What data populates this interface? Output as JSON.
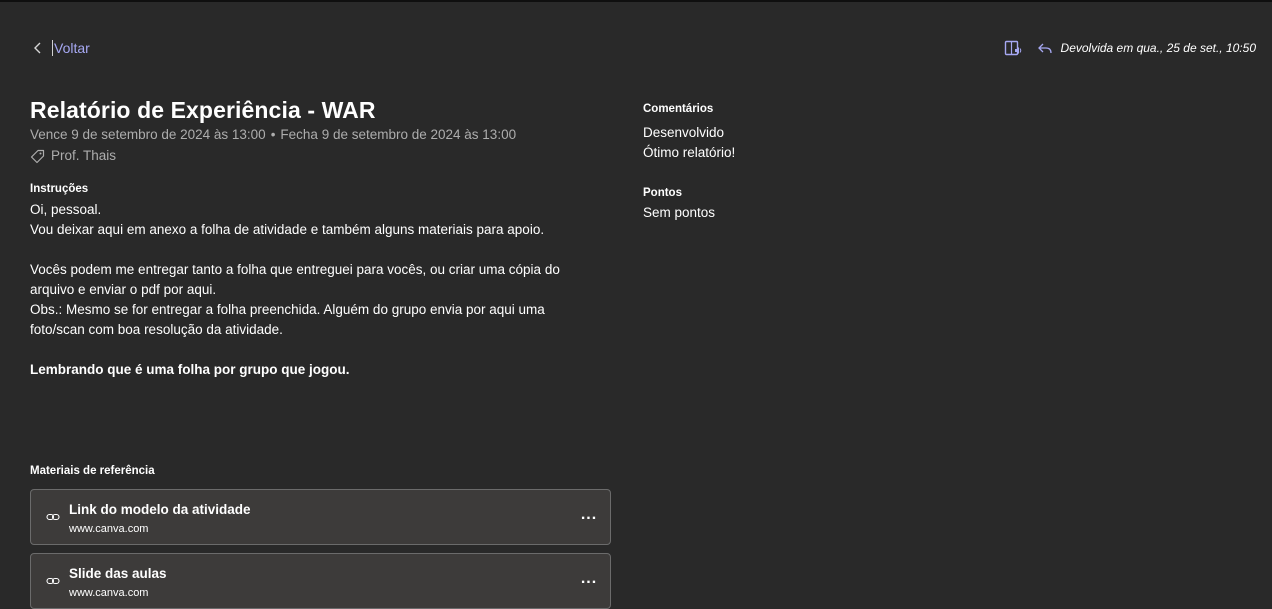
{
  "header": {
    "back_label": "Voltar",
    "returned_label": "Devolvida em qua., 25 de set., 10:50"
  },
  "assignment": {
    "title": "Relatório de Experiência - WAR",
    "due": "Vence 9 de setembro de 2024 às 13:00",
    "separator": "•",
    "closes": "Fecha 9 de setembro de 2024 às 13:00",
    "teacher": "Prof. Thais"
  },
  "instructions": {
    "heading": "Instruções",
    "lines": [
      "Oi, pessoal.",
      "Vou deixar aqui em anexo a folha de atividade e também alguns materiais para apoio.",
      "",
      "Vocês podem me entregar tanto a folha que entreguei para vocês, ou criar uma cópia do",
      "arquivo e enviar o pdf por aqui.",
      "Obs.: Mesmo se for entregar a folha preenchida. Alguém do grupo envia por aqui uma",
      "foto/scan com boa resolução da atividade.",
      "",
      "Lembrando que é uma folha por grupo que jogou."
    ]
  },
  "materials": {
    "heading": "Materiais de referência",
    "items": [
      {
        "title": "Link do modelo da atividade",
        "url": "www.canva.com",
        "more": "..."
      },
      {
        "title": "Slide das aulas",
        "url": "www.canva.com",
        "more": "..."
      }
    ]
  },
  "feedback": {
    "comments_heading": "Comentários",
    "comments": [
      "Desenvolvido",
      "Ótimo relatório!"
    ],
    "points_heading": "Pontos",
    "points_value": "Sem pontos"
  },
  "colors": {
    "background": "#292929",
    "accent": "#a6a8f2",
    "muted_text": "#adadad",
    "card_bg": "#3d3b3a",
    "card_border": "#6b6b6b"
  }
}
